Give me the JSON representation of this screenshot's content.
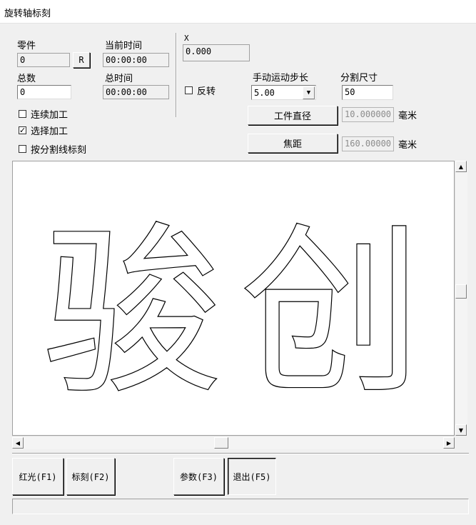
{
  "window": {
    "title": "旋转轴标刻"
  },
  "left": {
    "part_label": "零件",
    "part_value": "0",
    "reset_label": "R",
    "total_label": "总数",
    "total_value": "0",
    "current_time_label": "当前时间",
    "current_time_value": "00:00:00",
    "total_time_label": "总时间",
    "total_time_value": "00:00:00",
    "options": [
      {
        "label": "连续加工",
        "checked": false
      },
      {
        "label": "选择加工",
        "checked": true
      },
      {
        "label": "按分割线标刻",
        "checked": false
      }
    ]
  },
  "axis": {
    "x_label": "X",
    "x_value": "0.000",
    "reverse_label": "反转",
    "reverse_checked": false,
    "step_label": "手动运动步长",
    "step_value": "5.00",
    "split_label": "分割尺寸",
    "split_value": "50",
    "workpiece_button": "工件直径",
    "workpiece_value": "10.000000",
    "workpiece_unit": "毫米",
    "focus_button": "焦距",
    "focus_value": "160.00000",
    "focus_unit": "毫米"
  },
  "canvas": {
    "glyph_1": "骏",
    "glyph_2": "创"
  },
  "scroll": {
    "vertical_pos": 0.47,
    "horizontal_pos": 0.47
  },
  "bottom": {
    "red_light": "红光(F1)",
    "mark": "标刻(F2)",
    "params": "参数(F3)",
    "exit": "退出(F5)",
    "status": ""
  },
  "colors": {
    "window_bg": "#f0f0f0",
    "canvas_bg": "#ffffff",
    "outline": "#000000"
  }
}
